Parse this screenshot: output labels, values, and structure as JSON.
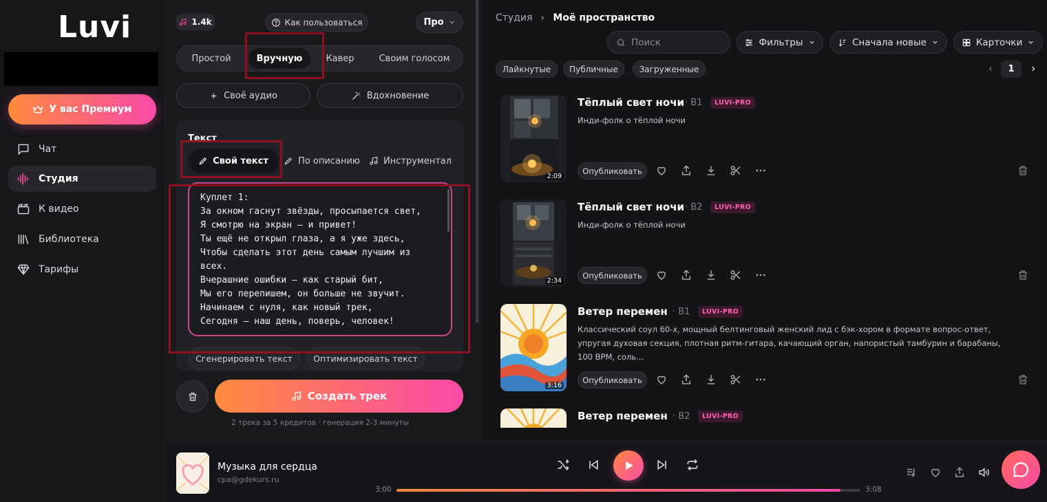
{
  "app": {
    "name": "Luvi"
  },
  "sidebar": {
    "premium_label": "У вас Премиум",
    "items": [
      {
        "label": "Чат",
        "icon": "chat-icon"
      },
      {
        "label": "Студия",
        "icon": "waveform-icon",
        "active": true
      },
      {
        "label": "К видео",
        "icon": "video-icon"
      },
      {
        "label": "Библиотека",
        "icon": "library-icon"
      },
      {
        "label": "Тарифы",
        "icon": "diamond-icon"
      }
    ]
  },
  "studio": {
    "credits": "1.4k",
    "howto_label": "Как пользоваться",
    "model_label": "Про",
    "modes": [
      "Простой",
      "Вручную",
      "Кавер",
      "Своим голосом"
    ],
    "active_mode": "Вручную",
    "own_audio_label": "Своё аудио",
    "inspiration_label": "Вдохновение",
    "text_section_title": "Текст",
    "text_tabs": [
      "Свой текст",
      "По описанию",
      "Инструментал"
    ],
    "active_text_tab": "Свой текст",
    "lyrics": "Куплет 1:\nЗа окном гаснут звёзды, просыпается свет,\nЯ смотрю на экран — и привет!\nТы ещё не открыл глаза, а я уже здесь,\nЧтобы сделать этот день самым лучшим из всех.\nВчерашние ошибки — как старый бит,\nМы его перепишем, он больше не звучит.\nНачинаем с нуля, как новый трек,\nСегодня — наш день, поверь, человек!",
    "generate_text_label": "Сгенерировать текст",
    "optimize_text_label": "Оптимизировать текст",
    "create_label": "Создать трек",
    "hint": "2 трека за 5 кредитов · генерация 2-3 минуты"
  },
  "workspace": {
    "breadcrumb_root": "Студия",
    "breadcrumb_current": "Моё пространство",
    "search_placeholder": "Поиск",
    "filters_label": "Фильтры",
    "sort_label": "Сначала новые",
    "view_label": "Карточки",
    "chips": [
      "Лайкнутые",
      "Публичные",
      "Загруженные"
    ],
    "page": "1",
    "publish_label": "Опубликовать",
    "tracks": [
      {
        "title": "Тёплый свет ночи",
        "version": "· B1",
        "badge": "LUVI-PRO",
        "desc": "Инди-фолк о тёплой ночи",
        "duration": "2:09",
        "cover": "night"
      },
      {
        "title": "Тёплый свет ночи",
        "version": "· B2",
        "badge": "LUVI-PRO",
        "desc": "Инди-фолк о тёплой ночи",
        "duration": "2:34",
        "cover": "night"
      },
      {
        "title": "Ветер перемен",
        "version": "· B1",
        "badge": "LUVI-PRO",
        "desc": "Классический соул 60-х, мощный белтинговый женский лид с бэк-хором в формате вопрос-ответ, упругая духовая секция, плотная ритм-гитара, качающий орган, напористый тамбурин и барабаны, 100 BPM, соль...",
        "duration": "3:16",
        "cover": "sun"
      },
      {
        "title": "Ветер перемен",
        "version": "· B2",
        "badge": "LUVI-PRO",
        "desc": "",
        "duration": "",
        "cover": "sun"
      }
    ]
  },
  "player": {
    "title": "Музыка для сердца",
    "subtitle": "cpa@gdekurs.ru",
    "current_time": "3:00",
    "total_time": "3:08",
    "progress": 0.957
  },
  "colors": {
    "accent_start": "#ff8a3d",
    "accent_end": "#f94aa8",
    "highlight_box": "#8e1022",
    "badge": "#ff5fae"
  }
}
